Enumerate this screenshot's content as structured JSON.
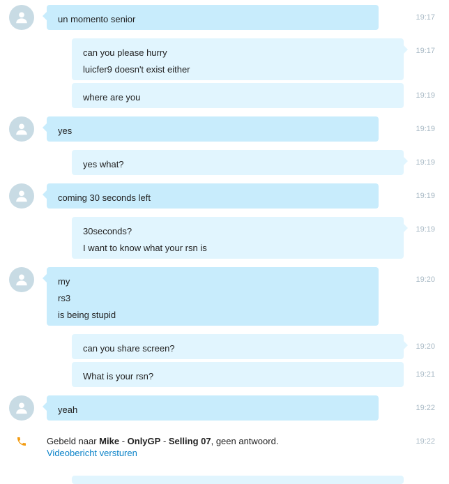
{
  "messages": [
    {
      "dir": "in",
      "avatar": true,
      "lines": [
        "un momento senior"
      ],
      "time": "19:17"
    },
    {
      "dir": "out",
      "avatar": false,
      "lines": [
        "can you please hurry",
        "luicfer9 doesn't exist either"
      ],
      "time": "19:17"
    },
    {
      "dir": "out",
      "avatar": false,
      "lines": [
        "where are you"
      ],
      "time": "19:19"
    },
    {
      "dir": "in",
      "avatar": true,
      "lines": [
        "yes"
      ],
      "time": "19:19"
    },
    {
      "dir": "out",
      "avatar": false,
      "lines": [
        "yes what?"
      ],
      "time": "19:19"
    },
    {
      "dir": "in",
      "avatar": true,
      "lines": [
        "coming 30 seconds left"
      ],
      "time": "19:19"
    },
    {
      "dir": "out",
      "avatar": false,
      "lines": [
        "30seconds?",
        "I want to know what your rsn is"
      ],
      "time": "19:19"
    },
    {
      "dir": "in",
      "avatar": true,
      "lines": [
        "my",
        "rs3",
        "is being stupid"
      ],
      "time": "19:20"
    },
    {
      "dir": "out",
      "avatar": false,
      "lines": [
        "can you share screen?"
      ],
      "time": "19:20"
    },
    {
      "dir": "out",
      "avatar": false,
      "lines": [
        "What is your rsn?"
      ],
      "time": "19:21"
    },
    {
      "dir": "in",
      "avatar": true,
      "lines": [
        "yeah"
      ],
      "time": "19:22"
    }
  ],
  "call_event": {
    "prefix": "Gebeld naar ",
    "name": "Mike",
    "sep1": " - ",
    "org": "OnlyGP",
    "sep2": " - ",
    "detail": "Selling 07",
    "suffix": ", geen antwoord.",
    "link": "Videobericht versturen",
    "time": "19:22",
    "icon": "phone-icon",
    "icon_color": "#f39c12"
  },
  "colors": {
    "incoming_bubble": "#c8ecfc",
    "outgoing_bubble": "#e1f5fe",
    "timestamp": "#a7b8c4",
    "link": "#0a82c8",
    "avatar_bg": "#c8dbe4"
  }
}
